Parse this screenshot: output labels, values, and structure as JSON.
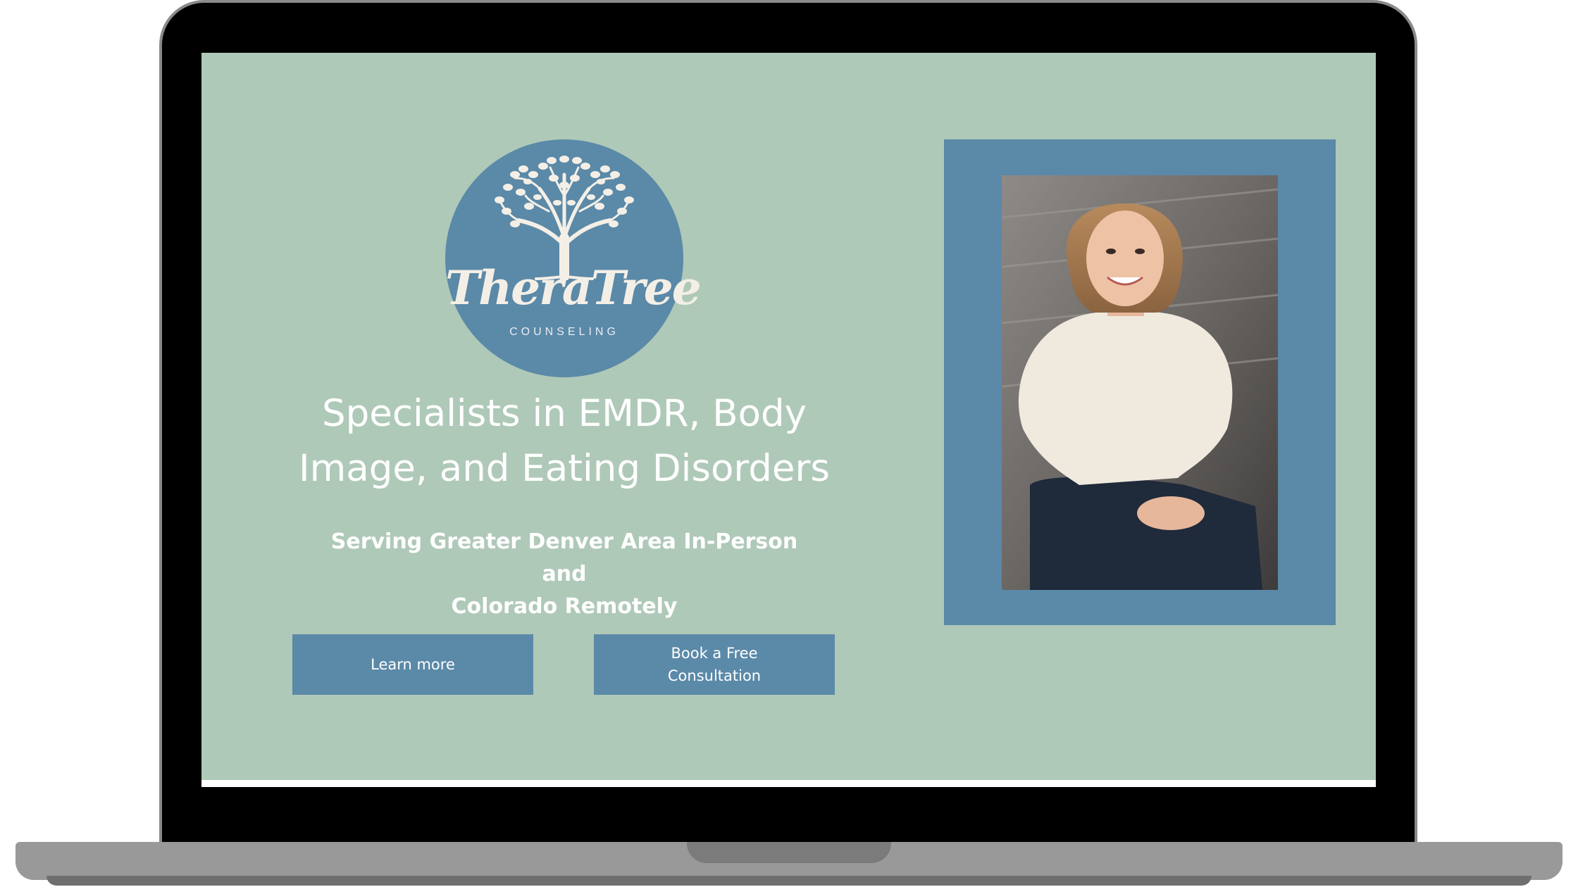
{
  "logo": {
    "wordmark": "TheraTree",
    "subtitle": "COUNSELING",
    "icon": "tree-icon"
  },
  "hero": {
    "headline_line1": "Specialists in EMDR, Body",
    "headline_line2": "Image, and Eating Disorders",
    "subheading_line1": "Serving Greater Denver Area In-Person and",
    "subheading_line2": "Colorado Remotely"
  },
  "buttons": {
    "learn_more": "Learn more",
    "book_line1": "Book a Free",
    "book_line2": "Consultation"
  },
  "photo": {
    "subject": "portrait-photo"
  },
  "colors": {
    "background": "#afc9b8",
    "accent_blue": "#5b89a8",
    "text": "#ffffff"
  }
}
